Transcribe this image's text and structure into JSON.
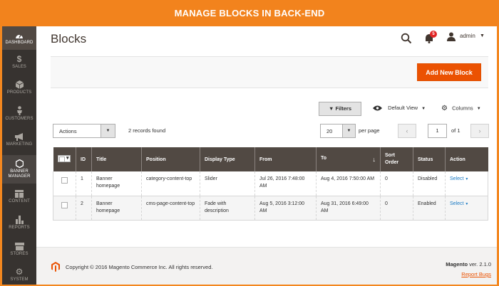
{
  "banner": {
    "title": "MANAGE BLOCKS IN BACK-END"
  },
  "sidebar": {
    "items": [
      {
        "label": "DASHBOARD",
        "icon": "dashboard-icon"
      },
      {
        "label": "SALES",
        "icon": "dollar-icon"
      },
      {
        "label": "PRODUCTS",
        "icon": "cube-icon"
      },
      {
        "label": "CUSTOMERS",
        "icon": "person-icon"
      },
      {
        "label": "MARKETING",
        "icon": "megaphone-icon"
      },
      {
        "label": "BANNER",
        "label2": "MANAGER",
        "icon": "hexagon-icon"
      },
      {
        "label": "CONTENT",
        "icon": "layout-icon"
      },
      {
        "label": "REPORTS",
        "icon": "bar-chart-icon"
      },
      {
        "label": "STORES",
        "icon": "store-icon"
      },
      {
        "label": "SYSTEM",
        "icon": "gear-icon"
      }
    ]
  },
  "header": {
    "title": "Blocks",
    "notifications_count": "5",
    "user": "admin"
  },
  "actions": {
    "add_new": "Add New Block"
  },
  "grid_controls": {
    "filters": "Filters",
    "view": "Default View",
    "columns": "Columns",
    "mass_action": "Actions",
    "records": "2 records found",
    "per_page": "20",
    "per_page_label": "per page",
    "page": "1",
    "of_pages": "of 1"
  },
  "table": {
    "columns": [
      "ID",
      "Title",
      "Position",
      "Display Type",
      "From",
      "To",
      "Sort Order",
      "Status",
      "Action"
    ],
    "rows": [
      {
        "id": "1",
        "title": "Banner homepage",
        "position": "category-content-top",
        "display_type": "Slider",
        "from": "Jul 26, 2016 7:48:00 AM",
        "to": "Aug 4, 2016 7:50:00 AM",
        "sort_order": "0",
        "status": "Disabled",
        "action": "Select"
      },
      {
        "id": "2",
        "title": "Banner homepage",
        "position": "cms-page-content-top",
        "display_type": "Fade with description",
        "from": "Aug 5, 2016 3:12:00 AM",
        "to": "Aug 31, 2016 6:49:00 AM",
        "sort_order": "0",
        "status": "Enabled",
        "action": "Select"
      }
    ]
  },
  "footer": {
    "copyright": "Copyright © 2016 Magento Commerce Inc. All rights reserved.",
    "brand": "Magento",
    "version": "ver. 2.1.0",
    "report": "Report Bugs"
  },
  "colors": {
    "accent": "#eb5202",
    "banner": "#f2831d",
    "sidebar": "#373330",
    "table_header": "#514943",
    "link": "#1979c3"
  }
}
